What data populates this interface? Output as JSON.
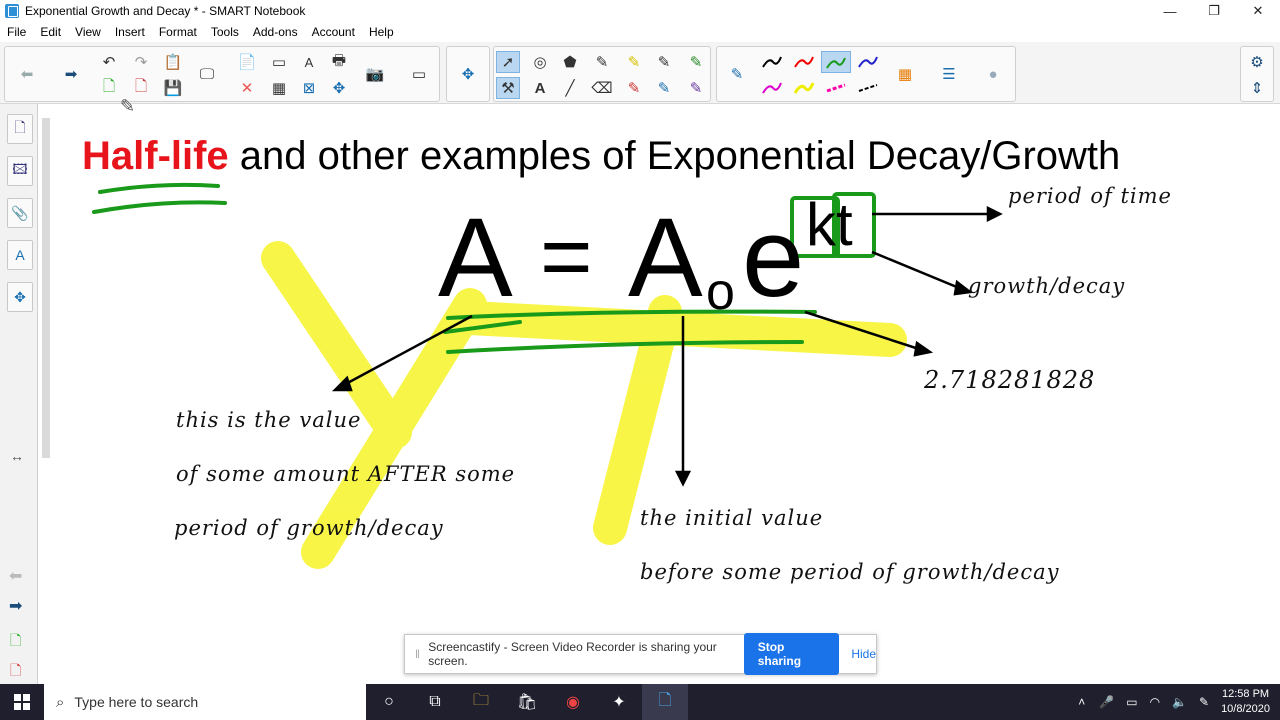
{
  "window": {
    "title": "Exponential Growth and Decay * - SMART Notebook",
    "minimize": "—",
    "restore": "❐",
    "close": "✕"
  },
  "menu": [
    "File",
    "Edit",
    "View",
    "Insert",
    "Format",
    "Tools",
    "Add-ons",
    "Account",
    "Help"
  ],
  "slide": {
    "title_highlight": "Half-life",
    "title_rest": " and other examples of Exponential Decay/Growth",
    "formula": {
      "A": "A",
      "equals": "=",
      "A0": "A",
      "sub": "o",
      "e": "e",
      "exp": "kt"
    },
    "notes": {
      "period_of_time": "period of time",
      "growth_decay": "growth/decay",
      "e_value": "2.718281828",
      "value_line1": "this is the value",
      "value_line2": "of some amount AFTER some",
      "value_line3": "period of growth/decay",
      "initial_line1": "the initial value",
      "initial_line2": "before some period of growth/decay"
    }
  },
  "notice": {
    "message": "Screencastify - Screen Video Recorder is sharing your screen.",
    "stop": "Stop sharing",
    "hide": "Hide"
  },
  "taskbar": {
    "search_placeholder": "Type here to search",
    "time": "12:58 PM",
    "date": "10/8/2020"
  },
  "colors": {
    "title_red": "#e8141c",
    "ink_green": "#1a9a1a",
    "highlighter_yellow": "#f5f20a",
    "stop_blue": "#1a73e8"
  }
}
